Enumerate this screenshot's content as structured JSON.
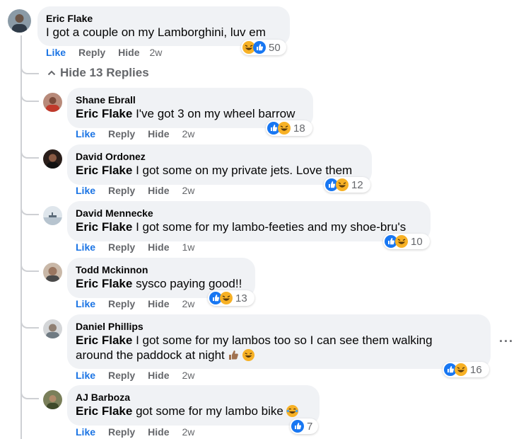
{
  "main_comment": {
    "author": "Eric Flake",
    "text": "I got a couple on my Lamborghini, luv em",
    "actions": {
      "like": "Like",
      "reply": "Reply",
      "hide": "Hide",
      "time": "2w"
    },
    "reaction_count": "50",
    "reaction_icons": [
      "haha-icon",
      "like-icon"
    ]
  },
  "replies_toggle": {
    "label": "Hide 13 Replies",
    "icon": "chevron-up-icon"
  },
  "replies": [
    {
      "author": "Shane Ebrall",
      "mention": "Eric Flake",
      "text": "I've got 3 on my wheel barrow",
      "text2": "",
      "time": "2w",
      "reaction_count": "18"
    },
    {
      "author": "David Ordonez",
      "mention": "Eric Flake",
      "text": "I got some on my private jets. Love them",
      "text2": "",
      "time": "2w",
      "reaction_count": "12"
    },
    {
      "author": "David Mennecke",
      "mention": "Eric Flake",
      "text": "I got some for my lambo-feeties and my shoe-bru's",
      "text2": "",
      "time": "1w",
      "reaction_count": "10"
    },
    {
      "author": "Todd Mckinnon",
      "mention": "Eric Flake",
      "text": "sysco paying good!!",
      "text2": "",
      "time": "2w",
      "reaction_count": "13"
    },
    {
      "author": "Daniel Phillips",
      "mention": "Eric Flake",
      "text": "I got some for my lambos too so I can see them walking",
      "text2": "around the paddock at night",
      "time": "2w",
      "reaction_count": "16"
    },
    {
      "author": "AJ Barboza",
      "mention": "Eric Flake",
      "text": "got some for my lambo bike",
      "text2": "",
      "time": "2w",
      "reaction_count": "7"
    }
  ],
  "labels": {
    "like": "Like",
    "reply": "Reply",
    "hide": "Hide"
  },
  "more_options": "···",
  "colors": {
    "like_blue": "#1877f2",
    "haha_yellow": "#f7b125",
    "bubble": "#f0f2f5",
    "meta_gray": "#65676b"
  }
}
